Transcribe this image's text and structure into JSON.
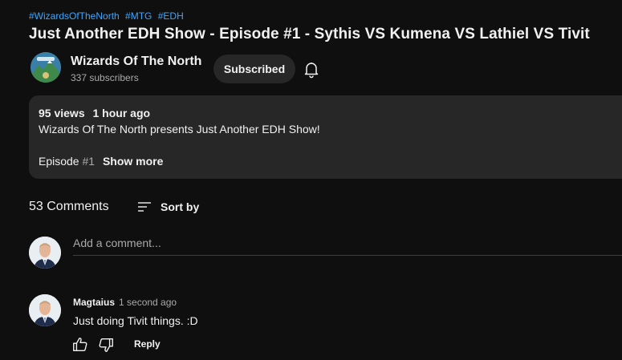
{
  "video": {
    "hashtags": [
      "#WizardsOfTheNorth",
      "#MTG",
      "#EDH"
    ],
    "title": "Just Another EDH Show - Episode #1 - Sythis VS Kumena VS Lathiel VS Tivit"
  },
  "channel": {
    "name": "Wizards Of The North",
    "subscribers": "337 subscribers",
    "subscribe_label": "Subscribed",
    "avatar_icon": "mountain-logo-icon",
    "notification_icon": "bell-icon"
  },
  "description": {
    "views": "95 views",
    "time": "1 hour ago",
    "line1": "Wizards Of The North presents Just Another EDH Show!",
    "episode_text": "Episode ",
    "episode_tag": "#1",
    "show_more": "Show more"
  },
  "comments": {
    "count": "53 Comments",
    "sort_label": "Sort by",
    "sort_icon": "sort-icon",
    "add_placeholder": "Add a comment...",
    "items": [
      {
        "author": "Magtaius",
        "time": "1 second ago",
        "text": "Just doing Tivit things. :D",
        "reply_label": "Reply",
        "like_icon": "thumbs-up-icon",
        "dislike_icon": "thumbs-down-icon"
      }
    ]
  },
  "colors": {
    "background": "#0f0f0f",
    "panel": "#272727",
    "link": "#3ea6ff",
    "text": "#f1f1f1",
    "muted": "#aaaaaa"
  }
}
